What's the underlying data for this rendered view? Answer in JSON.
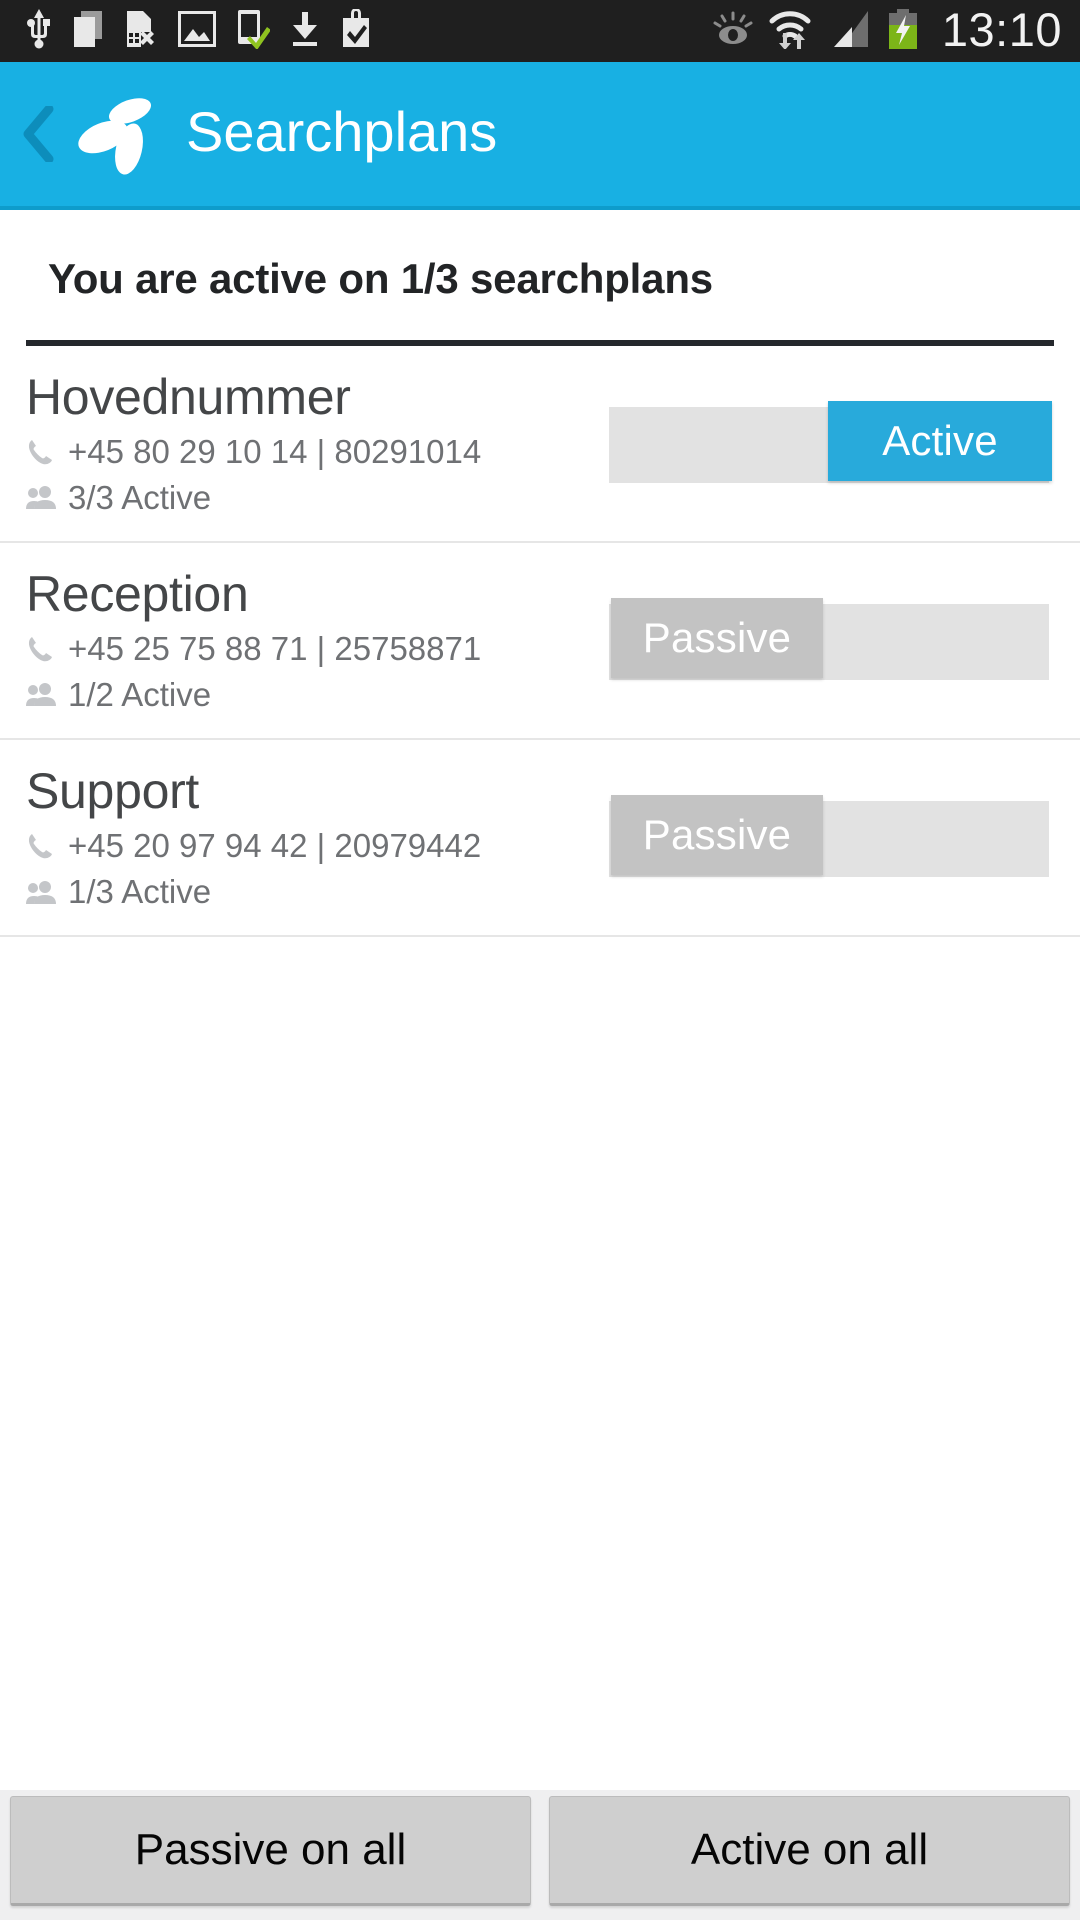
{
  "statusbar": {
    "time": "13:10",
    "left_icons": [
      "usb-icon",
      "copy-documents-icon",
      "sim-card-error-icon",
      "image-icon",
      "phone-sync-complete-icon",
      "download-icon",
      "shopping-bag-check-icon"
    ],
    "right_icons": [
      "smart-stay-eye-icon",
      "wifi-transfer-icon",
      "cellular-signal-icon",
      "battery-charging-icon"
    ],
    "background": "#1f1f1f"
  },
  "header": {
    "title": "Searchplans",
    "back_label": "‹",
    "logo": "telenor-propeller-logo",
    "background": "#18b0e3"
  },
  "main": {
    "subtitle": "You are active on 1/3 searchplans",
    "rows": [
      {
        "name": "Hovednummer",
        "phone": "+45 80 29 10 14 | 80291014",
        "members": "3/3 Active",
        "toggle_state": "on",
        "toggle_label": "Active"
      },
      {
        "name": "Reception",
        "phone": "+45 25 75 88 71 | 25758871",
        "members": "1/2 Active",
        "toggle_state": "off",
        "toggle_label": "Passive"
      },
      {
        "name": "Support",
        "phone": "+45 20 97 94 42 | 20979442",
        "members": "1/3 Active",
        "toggle_state": "off",
        "toggle_label": "Passive"
      }
    ]
  },
  "bottombar": {
    "passive_all_label": "Passive on all",
    "active_all_label": "Active on all"
  },
  "colors": {
    "accent": "#18b0e3",
    "toggle_on": "#28aadb",
    "toggle_off_thumb": "#c3c3c3",
    "toggle_track": "#e2e2e2",
    "button_face": "#cfcfcf"
  }
}
